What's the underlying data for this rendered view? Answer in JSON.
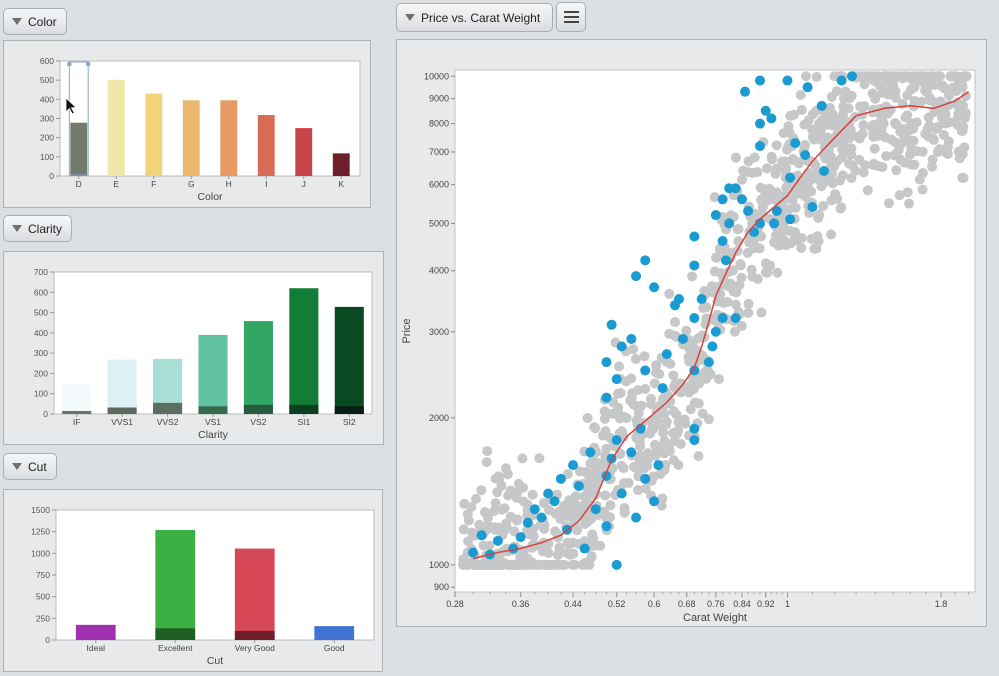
{
  "panels": {
    "color": {
      "header": "Color"
    },
    "clarity": {
      "header": "Clarity"
    },
    "cut": {
      "header": "Cut"
    },
    "scatter": {
      "header": "Price vs. Carat Weight"
    }
  },
  "icons": {
    "collapse": "triangle-down-icon",
    "menu": "hamburger-menu-icon",
    "cursor": "mouse-cursor-icon"
  },
  "colors": {
    "scatter_gray": "#c6c7c9",
    "scatter_highlight": "#1a9bd1",
    "smooth_line": "#d9413a"
  },
  "chart_data": [
    {
      "id": "color",
      "type": "bar",
      "xlabel": "Color",
      "ylabel": "",
      "ylim": [
        0,
        600
      ],
      "yticks": [
        0,
        100,
        200,
        300,
        400,
        500,
        600
      ],
      "categories": [
        "D",
        "E",
        "F",
        "G",
        "H",
        "I",
        "J",
        "K"
      ],
      "values": [
        278,
        502,
        430,
        395,
        395,
        318,
        250,
        118
      ],
      "colors": [
        "#737a6c",
        "#ede8a7",
        "#f2d37a",
        "#ecb86f",
        "#e89a65",
        "#d86b55",
        "#c8444b",
        "#6d1f2a"
      ],
      "selected": "D"
    },
    {
      "id": "clarity",
      "type": "bar",
      "xlabel": "Clarity",
      "ylabel": "",
      "ylim": [
        0,
        700
      ],
      "yticks": [
        0,
        100,
        200,
        300,
        400,
        500,
        600,
        700
      ],
      "categories": [
        "IF",
        "VVS1",
        "VVS2",
        "VS1",
        "VS2",
        "SI1",
        "SI2"
      ],
      "series": [
        {
          "values": [
            145,
            268,
            272,
            390,
            458,
            620,
            528
          ],
          "colors": [
            "#f3fafc",
            "#dcf1f3",
            "#a9ded4",
            "#5fc19e",
            "#33a564",
            "#137c36",
            "#0a4a23"
          ]
        },
        {
          "values": [
            15,
            32,
            55,
            38,
            45,
            45,
            38
          ],
          "colors": [
            "#6a726a",
            "#5e6962",
            "#5c6d62",
            "#3a6a4e",
            "#2a5a3c",
            "#0c3f1e",
            "#081e12"
          ]
        }
      ]
    },
    {
      "id": "cut",
      "type": "bar",
      "xlabel": "Cut",
      "ylabel": "",
      "ylim": [
        0,
        1500
      ],
      "yticks": [
        0,
        250,
        500,
        750,
        1000,
        1250,
        1500
      ],
      "categories": [
        "Ideal",
        "Excellent",
        "Very Good",
        "Good"
      ],
      "series": [
        {
          "values": [
            175,
            1270,
            1055,
            160
          ],
          "colors": [
            "#a02fb2",
            "#3bb043",
            "#d64856",
            "#3f74d4"
          ]
        },
        {
          "values": [
            0,
            135,
            105,
            0
          ],
          "colors": [
            "#5c1a66",
            "#1e5f24",
            "#6e1e28",
            "#203a6b"
          ]
        }
      ]
    },
    {
      "id": "scatter",
      "type": "scatter",
      "xlabel": "Carat Weight",
      "ylabel": "Price",
      "xscale": "log",
      "yscale": "log",
      "xlim": [
        0.28,
        2.05
      ],
      "ylim": [
        880,
        10300
      ],
      "xticks": [
        0.28,
        0.36,
        0.44,
        0.52,
        0.6,
        0.68,
        0.76,
        0.84,
        0.92,
        1,
        1.8
      ],
      "xtick_labels": [
        "0.28",
        "0.36",
        "0.44",
        "0.52",
        "0.6",
        "0.68",
        "0.76",
        "0.84",
        "0.92",
        "1",
        "1.8"
      ],
      "yticks": [
        900,
        1000,
        2000,
        3000,
        4000,
        5000,
        6000,
        7000,
        8000,
        9000,
        10000
      ],
      "ytick_labels": [
        "900",
        "1000",
        "2000",
        "3000",
        "4000",
        "5000",
        "6000",
        "7000",
        "8000",
        "9000",
        "10000"
      ],
      "series": [
        {
          "color": "#1a9bd1",
          "points": [
            [
              0.3,
              1060
            ],
            [
              0.31,
              1150
            ],
            [
              0.32,
              1050
            ],
            [
              0.33,
              1120
            ],
            [
              0.35,
              1080
            ],
            [
              0.36,
              1140
            ],
            [
              0.37,
              1220
            ],
            [
              0.38,
              1300
            ],
            [
              0.39,
              1250
            ],
            [
              0.4,
              1400
            ],
            [
              0.41,
              1350
            ],
            [
              0.42,
              1500
            ],
            [
              0.43,
              1180
            ],
            [
              0.44,
              1600
            ],
            [
              0.45,
              1450
            ],
            [
              0.46,
              1080
            ],
            [
              0.47,
              1700
            ],
            [
              0.48,
              1300
            ],
            [
              0.5,
              1520
            ],
            [
              0.5,
              1200
            ],
            [
              0.51,
              1650
            ],
            [
              0.52,
              1000
            ],
            [
              0.52,
              1800
            ],
            [
              0.53,
              1400
            ],
            [
              0.55,
              1700
            ],
            [
              0.56,
              1250
            ],
            [
              0.57,
              1900
            ],
            [
              0.58,
              1500
            ],
            [
              0.6,
              1350
            ],
            [
              0.61,
              1600
            ],
            [
              0.5,
              2200
            ],
            [
              0.5,
              2600
            ],
            [
              0.51,
              3100
            ],
            [
              0.52,
              2400
            ],
            [
              0.53,
              2800
            ],
            [
              0.55,
              2900
            ],
            [
              0.58,
              2500
            ],
            [
              0.62,
              2300
            ],
            [
              0.63,
              2700
            ],
            [
              0.65,
              3400
            ],
            [
              0.66,
              3500
            ],
            [
              0.67,
              2900
            ],
            [
              0.56,
              3900
            ],
            [
              0.58,
              4200
            ],
            [
              0.6,
              3700
            ],
            [
              0.7,
              1900
            ],
            [
              0.7,
              1800
            ],
            [
              0.7,
              2500
            ],
            [
              0.7,
              3200
            ],
            [
              0.7,
              4100
            ],
            [
              0.7,
              4700
            ],
            [
              0.72,
              3500
            ],
            [
              0.74,
              2600
            ],
            [
              0.75,
              2800
            ],
            [
              0.76,
              3000
            ],
            [
              0.76,
              5200
            ],
            [
              0.78,
              5600
            ],
            [
              0.78,
              4600
            ],
            [
              0.79,
              4200
            ],
            [
              0.8,
              5000
            ],
            [
              0.8,
              5900
            ],
            [
              0.82,
              5900
            ],
            [
              0.84,
              5600
            ],
            [
              0.86,
              5300
            ],
            [
              0.88,
              4800
            ],
            [
              0.9,
              5000
            ],
            [
              0.9,
              7200
            ],
            [
              0.9,
              8000
            ],
            [
              0.9,
              9800
            ],
            [
              0.92,
              8500
            ],
            [
              0.94,
              8200
            ],
            [
              0.95,
              5000
            ],
            [
              0.96,
              5300
            ],
            [
              1.0,
              9800
            ],
            [
              1.01,
              6200
            ],
            [
              1.01,
              5100
            ],
            [
              1.03,
              7300
            ],
            [
              1.07,
              6900
            ],
            [
              1.08,
              9500
            ],
            [
              1.1,
              5400
            ],
            [
              1.14,
              8700
            ],
            [
              1.15,
              6400
            ],
            [
              1.23,
              9800
            ],
            [
              1.28,
              10000
            ],
            [
              0.85,
              9300
            ],
            [
              0.78,
              3200
            ],
            [
              0.82,
              3200
            ]
          ]
        },
        {
          "color": "#d9413a",
          "type": "line",
          "points": [
            [
              0.3,
              1030
            ],
            [
              0.33,
              1060
            ],
            [
              0.36,
              1080
            ],
            [
              0.39,
              1110
            ],
            [
              0.42,
              1150
            ],
            [
              0.45,
              1230
            ],
            [
              0.48,
              1370
            ],
            [
              0.51,
              1640
            ],
            [
              0.54,
              1830
            ],
            [
              0.58,
              1970
            ],
            [
              0.63,
              2150
            ],
            [
              0.67,
              2340
            ],
            [
              0.7,
              2530
            ],
            [
              0.72,
              2800
            ],
            [
              0.74,
              3150
            ],
            [
              0.76,
              3550
            ],
            [
              0.79,
              3950
            ],
            [
              0.82,
              4350
            ],
            [
              0.86,
              4800
            ],
            [
              0.9,
              5100
            ],
            [
              0.95,
              5400
            ],
            [
              1.0,
              5700
            ],
            [
              1.05,
              6200
            ],
            [
              1.1,
              6700
            ],
            [
              1.15,
              7100
            ],
            [
              1.2,
              7500
            ],
            [
              1.3,
              8300
            ],
            [
              1.45,
              8600
            ],
            [
              1.6,
              8700
            ],
            [
              1.75,
              8600
            ],
            [
              1.9,
              8900
            ],
            [
              2.0,
              9300
            ]
          ]
        }
      ]
    }
  ]
}
